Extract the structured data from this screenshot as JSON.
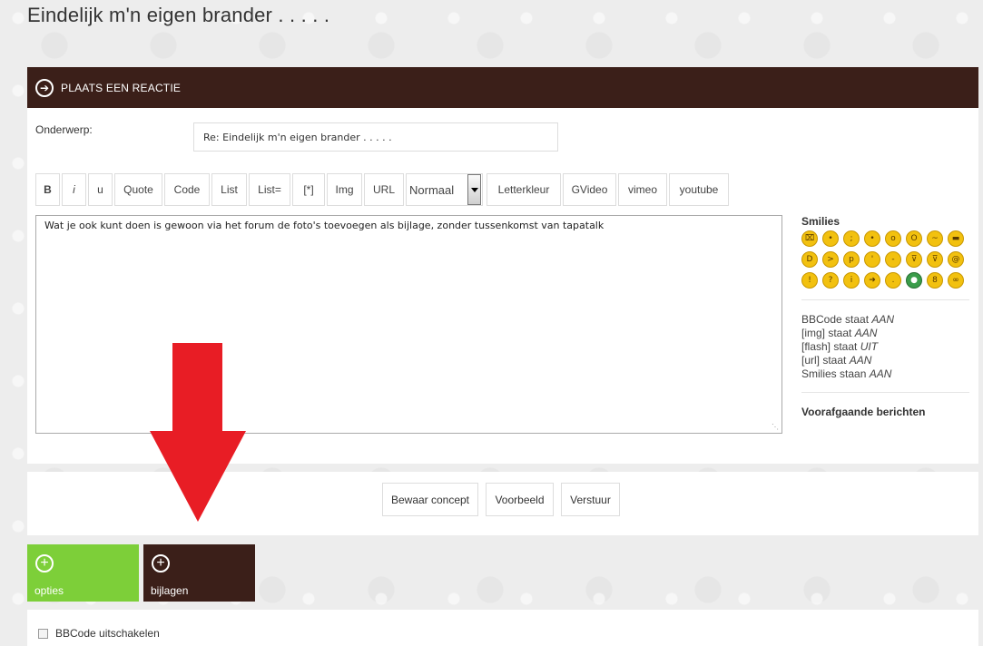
{
  "page": {
    "title": "Eindelijk m'n eigen brander . . . . ."
  },
  "header": {
    "title": "PLAATS EEN REACTIE",
    "icon": "arrow-circle-icon"
  },
  "subject": {
    "label": "Onderwerp:",
    "value": "Re: Eindelijk m'n eigen brander . . . . ."
  },
  "toolbar": {
    "buttons": [
      "B",
      "i",
      "u",
      "Quote",
      "Code",
      "List",
      "List=",
      "[*]",
      "Img",
      "URL"
    ],
    "size_select": "Normaal",
    "buttons_after": [
      "Letterkleur",
      "GVideo",
      "vimeo",
      "youtube"
    ]
  },
  "message": {
    "text": "Wat je ook kunt doen is gewoon via het forum de foto's toevoegen als bijlage, zonder tussenkomst van tapatalk"
  },
  "sidebar": {
    "smilies_title": "Smilies",
    "status": [
      {
        "text": "BBCode staat",
        "value": "AAN"
      },
      {
        "text": "[img] staat",
        "value": "AAN"
      },
      {
        "text": "[flash] staat",
        "value": "UIT"
      },
      {
        "text": "[url] staat",
        "value": "AAN"
      },
      {
        "text": "Smilies staan",
        "value": "AAN"
      }
    ],
    "previous_posts": "Voorafgaande berichten"
  },
  "actions": {
    "save_draft": "Bewaar concept",
    "preview": "Voorbeeld",
    "submit": "Verstuur"
  },
  "tiles": {
    "options": {
      "label": "opties",
      "color": "#7dcf39"
    },
    "attachments": {
      "label": "bijlagen",
      "color": "#3b1f19"
    }
  },
  "options": {
    "disable_bbcode": "BBCode uitschakelen"
  },
  "colors": {
    "brand": "#3b1f19",
    "arrow": "#e81d25"
  }
}
